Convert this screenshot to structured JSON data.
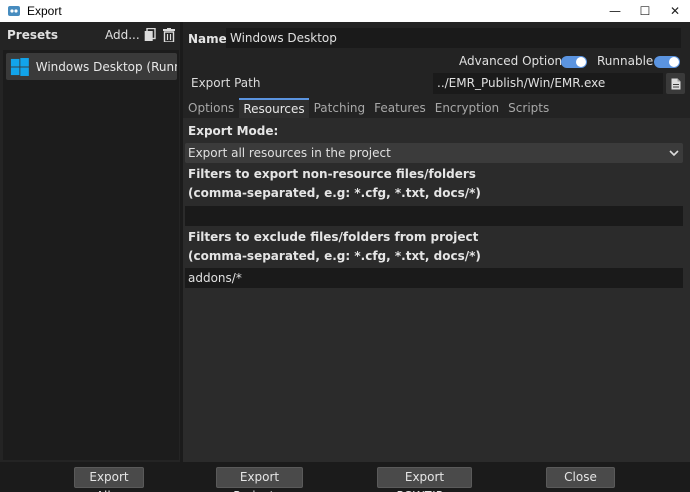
{
  "window": {
    "title": "Export",
    "controls": {
      "minimize": "—",
      "maximize": "☐",
      "close": "✕"
    }
  },
  "presets": {
    "title": "Presets",
    "add_label": "Add...",
    "items": [
      {
        "label": "Windows Desktop (Runn...",
        "icon": "windows-logo-icon"
      }
    ]
  },
  "details": {
    "name_label": "Name:",
    "name_value": "Windows Desktop",
    "advanced_options_label": "Advanced Options",
    "advanced_options_on": true,
    "runnable_label": "Runnable",
    "runnable_on": true,
    "export_path_label": "Export Path",
    "export_path_value": "../EMR_Publish/Win/EMR.exe"
  },
  "tabs": [
    {
      "label": "Options",
      "active": false
    },
    {
      "label": "Resources",
      "active": true
    },
    {
      "label": "Patching",
      "active": false
    },
    {
      "label": "Features",
      "active": false
    },
    {
      "label": "Encryption",
      "active": false
    },
    {
      "label": "Scripts",
      "active": false
    }
  ],
  "resources": {
    "export_mode_label": "Export Mode:",
    "export_mode_value": "Export all resources in the project",
    "include_filter_label_line1": "Filters to export non-resource files/folders",
    "include_filter_label_line2": "(comma-separated, e.g: *.cfg, *.txt, docs/*)",
    "include_filter_value": "",
    "exclude_filter_label_line1": "Filters to exclude files/folders from project",
    "exclude_filter_label_line2": "(comma-separated, e.g: *.cfg, *.txt, docs/*)",
    "exclude_filter_value": "addons/*"
  },
  "footer": {
    "export_all": "Export All...",
    "export_project": "Export Project...",
    "export_pck": "Export PCK/ZIP...",
    "close": "Close"
  },
  "colors": {
    "accent": "#5b94e0",
    "windows_blue": "#12a4ea"
  }
}
